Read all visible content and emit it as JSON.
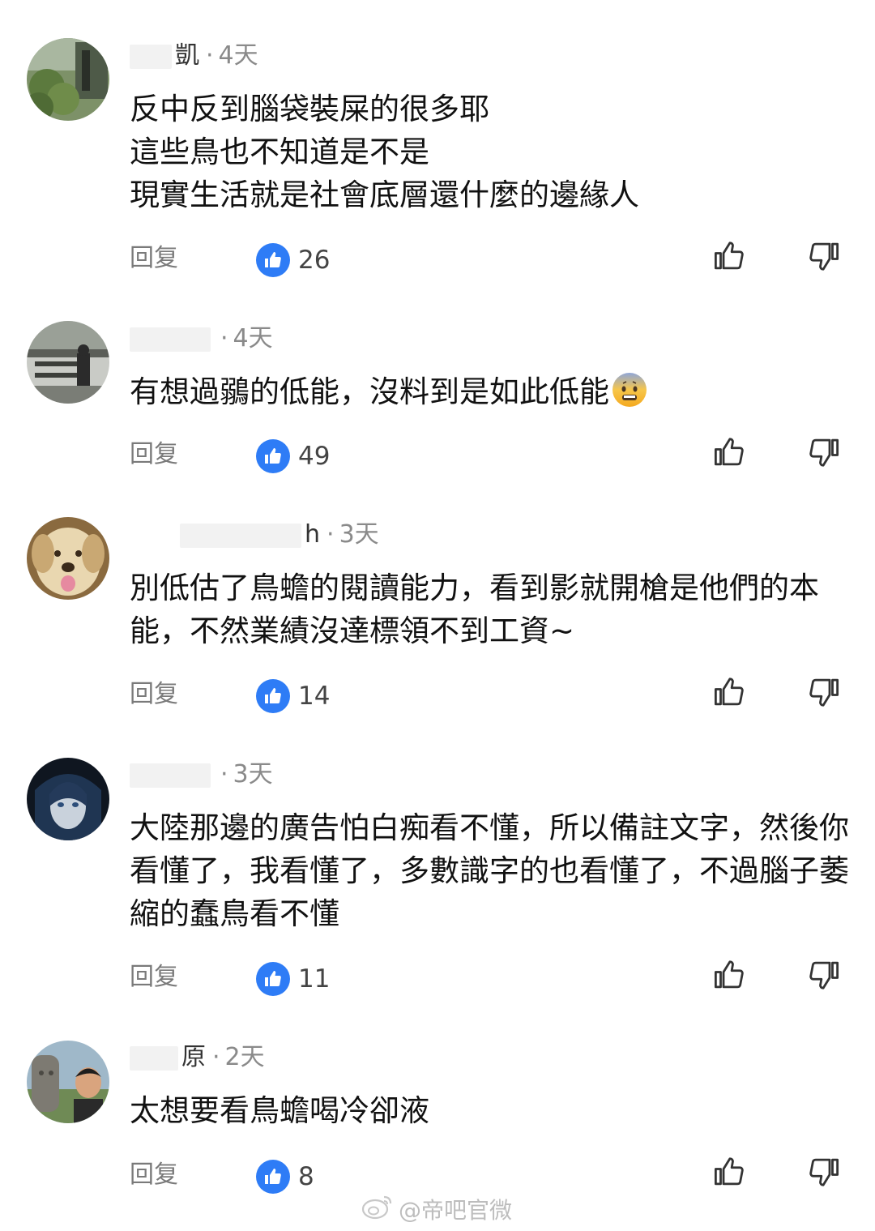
{
  "comments": [
    {
      "name": "凱",
      "time": "4天",
      "text": "反中反到腦袋裝屎的很多耶\n這些鳥也不知道是不是\n現實生活就是社會底層還什麼的邊緣人",
      "reply_label": "回复",
      "likes": "26",
      "avatar_icon": "garden-avatar"
    },
    {
      "name": "",
      "time": "4天",
      "text": "有想過鶸的低能，沒料到是如此低能",
      "emoji": "fearful-face-emoji",
      "reply_label": "回复",
      "likes": "49",
      "avatar_icon": "street-photo-avatar"
    },
    {
      "name": "h",
      "time": "3天",
      "text": "別低估了鳥蟾的閱讀能力，看到影就開槍是他們的本能，不然業績沒達標領不到工資~",
      "reply_label": "回复",
      "likes": "14",
      "avatar_icon": "dog-avatar"
    },
    {
      "name": "",
      "time": "3天",
      "text": "大陸那邊的廣告怕白痴看不懂，所以備註文字，然後你看懂了，我看懂了，多數識字的也看懂了，不過腦子萎縮的蠢鳥看不懂",
      "reply_label": "回复",
      "likes": "11",
      "avatar_icon": "anime-girl-avatar"
    },
    {
      "name": "原",
      "time": "2天",
      "text": "太想要看鳥蟾喝冷卻液",
      "reply_label": "回复",
      "likes": "8",
      "avatar_icon": "statue-selfie-avatar"
    }
  ],
  "watermark": "@帝吧官微",
  "icons": {
    "like_badge": "thumbs-up-badge-icon",
    "like_action": "thumbs-up-outline-icon",
    "dislike_action": "thumbs-down-outline-icon",
    "weibo": "weibo-logo-icon"
  },
  "colors": {
    "accent": "#2e7cf6",
    "meta": "#8a8a8a",
    "text": "#111111"
  }
}
